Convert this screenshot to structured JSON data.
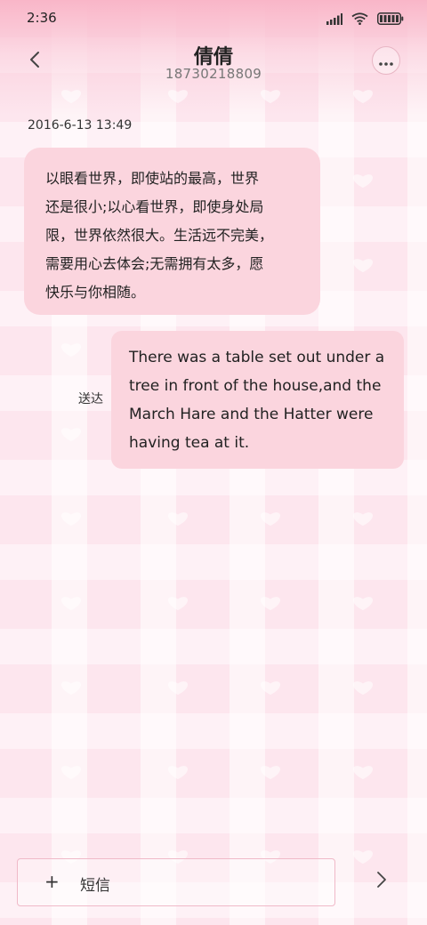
{
  "status_bar": {
    "time": "2:36",
    "icons": [
      "signal-icon",
      "wifi-icon",
      "battery-icon"
    ]
  },
  "header": {
    "contact_name": "倩倩",
    "phone_number": "18730218809",
    "back_icon": "chevron-left-icon",
    "more_icon": "more-options-icon"
  },
  "conversation": {
    "timestamp": "2016-6-13 13:49",
    "messages": [
      {
        "direction": "incoming",
        "text": "以眼看世界，即使站的最高，世界\n还是很小;以心看世界，即使身处局\n限，世界依然很大。生活远不完美，\n需要用心去体会;无需拥有太多，愿\n快乐与你相随。"
      },
      {
        "direction": "outgoing",
        "text": "There was a table set out under a tree in front of the house,and the March Hare and the Hatter were having tea at it.",
        "status": "送达"
      }
    ]
  },
  "composer": {
    "attach_symbol": "+",
    "placeholder": "短信",
    "send_icon": "chevron-right-icon"
  },
  "colors": {
    "background": "#fde6ee",
    "bubble": "#fbd5de",
    "accent_border": "#f0b9c8"
  }
}
